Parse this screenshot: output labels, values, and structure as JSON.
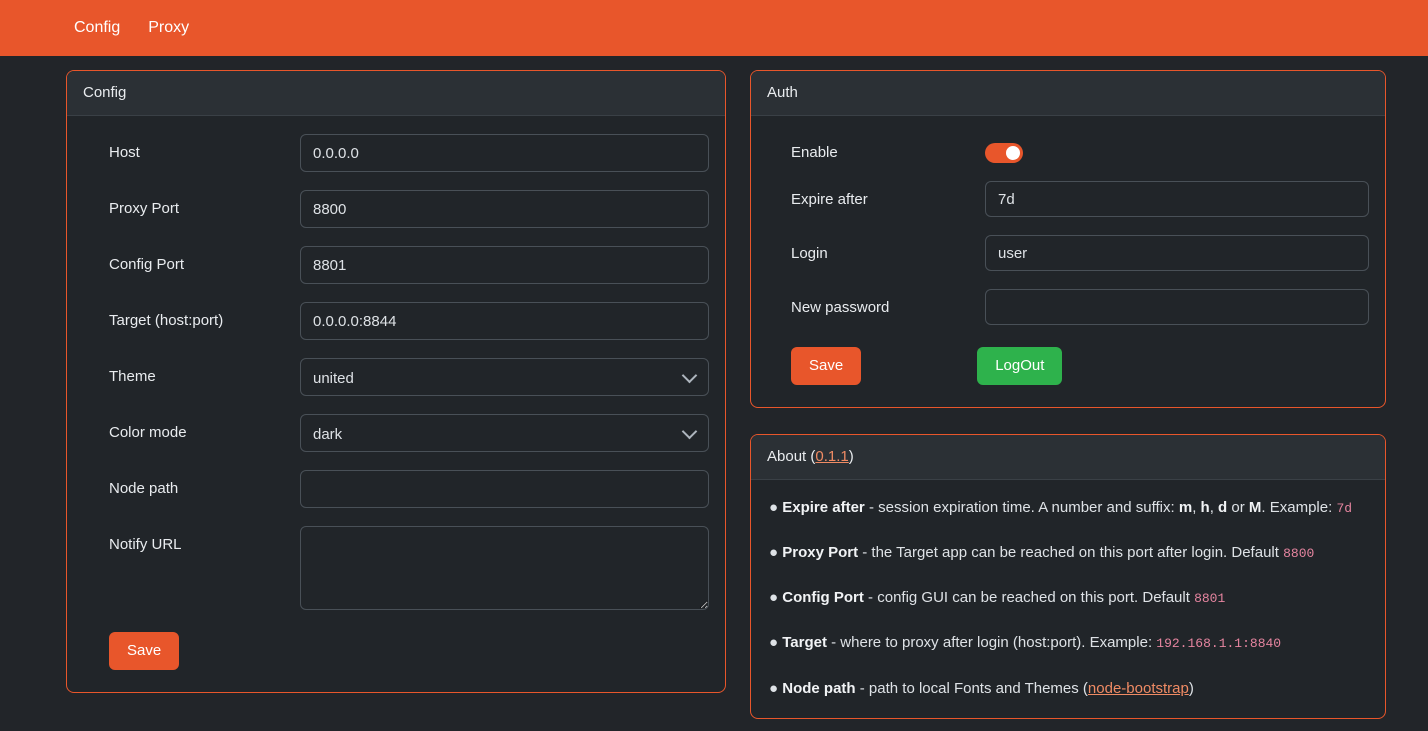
{
  "navbar": {
    "brand_color": "#e8562b",
    "links": [
      {
        "label": "Config"
      },
      {
        "label": "Proxy"
      }
    ]
  },
  "config_card": {
    "title": "Config",
    "fields": {
      "host": {
        "label": "Host",
        "value": "0.0.0.0",
        "placeholder": ""
      },
      "proxy_port": {
        "label": "Proxy Port",
        "value": "8800",
        "placeholder": ""
      },
      "config_port": {
        "label": "Config Port",
        "value": "8801",
        "placeholder": ""
      },
      "target": {
        "label": "Target (host:port)",
        "value": "0.0.0.0:8844",
        "placeholder": ""
      },
      "theme": {
        "label": "Theme",
        "value": "united",
        "options": [
          "united"
        ]
      },
      "color_mode": {
        "label": "Color mode",
        "value": "dark",
        "options": [
          "dark"
        ]
      },
      "node_path": {
        "label": "Node path",
        "value": "",
        "placeholder": ""
      },
      "notify_url": {
        "label": "Notify URL",
        "value": "",
        "placeholder": ""
      }
    },
    "save_label": "Save"
  },
  "auth_card": {
    "title": "Auth",
    "fields": {
      "enable": {
        "label": "Enable",
        "value": true
      },
      "expire_after": {
        "label": "Expire after",
        "value": "7d",
        "placeholder": ""
      },
      "login": {
        "label": "Login",
        "value": "user",
        "placeholder": ""
      },
      "new_password": {
        "label": "New password",
        "value": "",
        "placeholder": ""
      }
    },
    "save_label": "Save",
    "logout_label": "LogOut"
  },
  "about_card": {
    "title_prefix": "About (",
    "version": "0.1.1",
    "title_suffix": ")",
    "items": [
      {
        "term": "Expire after",
        "text_1": " - session expiration time. A number and suffix: ",
        "suffix_m": "m",
        "sep_1": ", ",
        "suffix_h": "h",
        "sep_2": ", ",
        "suffix_d": "d",
        "sep_3": " or ",
        "suffix_M": "M",
        "text_2": ". Example: ",
        "code": "7d"
      },
      {
        "term": "Proxy Port",
        "text_1": " - the Target app can be reached on this port after login. Default ",
        "code": "8800"
      },
      {
        "term": "Config Port",
        "text_1": " - config GUI can be reached on this port. Default ",
        "code": "8801"
      },
      {
        "term": "Target",
        "text_1": " - where to proxy after login (host:port). Example: ",
        "code": "192.168.1.1:8840"
      },
      {
        "term": "Node path",
        "text_1": " - path to local Fonts and Themes (",
        "link": "node-bootstrap",
        "text_2": ")"
      }
    ],
    "bullet": "●"
  }
}
